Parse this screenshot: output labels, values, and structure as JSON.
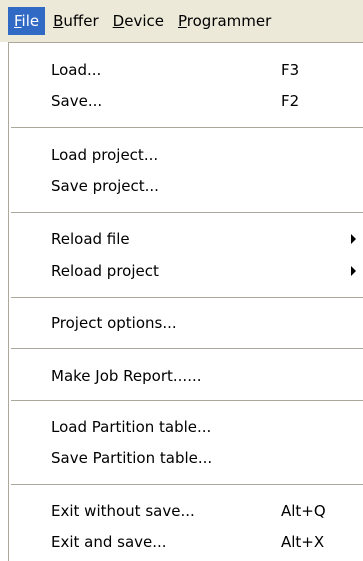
{
  "menubar": {
    "items": [
      {
        "label_first": "F",
        "label_rest": "ile"
      },
      {
        "label_first": "B",
        "label_rest": "uffer"
      },
      {
        "label_first": "D",
        "label_rest": "evice"
      },
      {
        "label_first": "P",
        "label_rest": "rogrammer"
      }
    ]
  },
  "file_menu": {
    "items": [
      {
        "label": "Load...",
        "shortcut": "F3"
      },
      {
        "label": "Save...",
        "shortcut": "F2"
      },
      {
        "label": "Load project..."
      },
      {
        "label": "Save project..."
      },
      {
        "label": "Reload file"
      },
      {
        "label": "Reload project"
      },
      {
        "label": "Project options..."
      },
      {
        "label": "Make Job Report......"
      },
      {
        "label": "Load Partition table..."
      },
      {
        "label": "Save Partition table..."
      },
      {
        "label": "Exit without save...",
        "shortcut": "Alt+Q"
      },
      {
        "label": "Exit and save...",
        "shortcut": "Alt+X"
      }
    ],
    "submenu_arrow_icon": "chevron-right-icon",
    "highlight_color": "#316ac5"
  }
}
